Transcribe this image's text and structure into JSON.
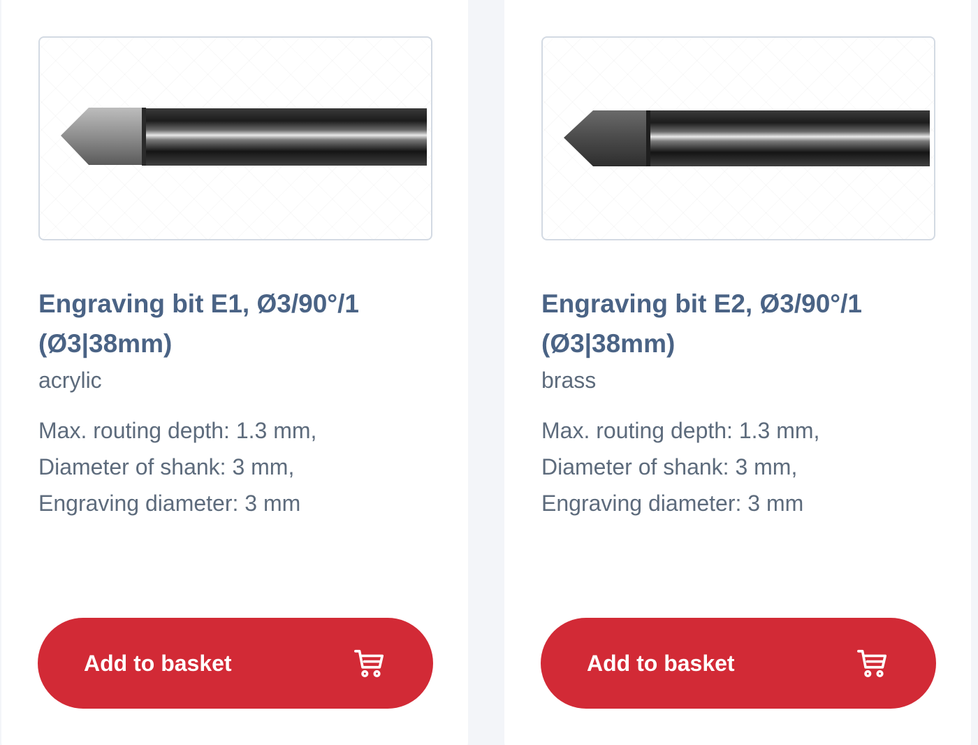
{
  "products": [
    {
      "title_line1": "Engraving bit E1, Ø3/90°/1",
      "title_line2": "(Ø3|38mm)",
      "material": "acrylic",
      "specs": [
        "Max. routing depth: 1.3 mm,",
        "Diameter of shank: 3 mm,",
        "Engraving diameter: 3 mm"
      ],
      "button_label": "Add to basket",
      "button_icon": "cart-icon"
    },
    {
      "title_line1": "Engraving bit E2, Ø3/90°/1",
      "title_line2": "(Ø3|38mm)",
      "material": "brass",
      "specs": [
        "Max. routing depth: 1.3 mm,",
        "Diameter of shank: 3 mm,",
        "Engraving diameter: 3 mm"
      ],
      "button_label": "Add to basket",
      "button_icon": "cart-icon"
    }
  ],
  "colors": {
    "button": "#d22a36",
    "title": "#4a6385",
    "text": "#5d6b7c",
    "background": "#f3f5f9"
  }
}
